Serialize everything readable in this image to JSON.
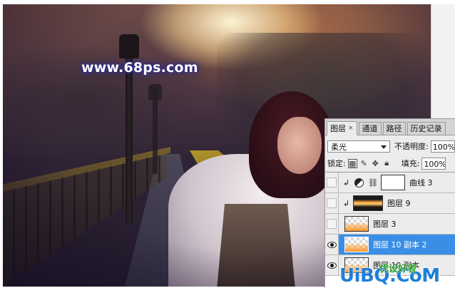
{
  "canvas": {
    "watermark": "www.68ps.com"
  },
  "panel": {
    "tabs": [
      {
        "label": "图层",
        "close": "×",
        "active": true
      },
      {
        "label": "通道",
        "active": false
      },
      {
        "label": "路径",
        "active": false
      },
      {
        "label": "历史记录",
        "active": false
      }
    ],
    "blend_mode": "柔光",
    "opacity_label": "不透明度:",
    "opacity_value": "100%",
    "lock_label": "锁定:",
    "fill_label": "填充:",
    "fill_value": "100%",
    "layers": [
      {
        "name": "曲线 3",
        "visible": false,
        "clipped": true,
        "type": "adjustment"
      },
      {
        "name": "图层 9",
        "visible": false,
        "clipped": true,
        "type": "image"
      },
      {
        "name": "图层 3",
        "visible": false,
        "clipped": false,
        "type": "transparent",
        "selected": false
      },
      {
        "name": "图层 10 副本 2",
        "visible": true,
        "clipped": false,
        "type": "transparent",
        "selected": true
      },
      {
        "name": "图层 10 副本",
        "visible": true,
        "clipped": false,
        "type": "transparent",
        "selected": false
      }
    ]
  },
  "logo": {
    "main": "UiBQ.CoM",
    "sub": "优设好者"
  }
}
